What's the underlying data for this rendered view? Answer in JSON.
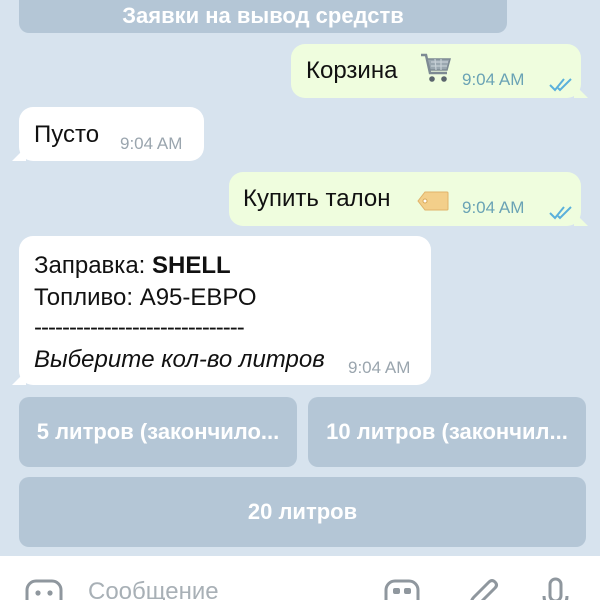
{
  "keyboard": {
    "top_button": "Заявки на вывод средств",
    "button_5l": "5 литров (закончило...",
    "button_10l": "10 литров (закончил...",
    "button_20l": "20 литров"
  },
  "messages": [
    {
      "direction": "out",
      "text": "Корзина",
      "emoji": "🛒",
      "time": "9:04 AM",
      "status": "read"
    },
    {
      "direction": "in",
      "text": "Пусто",
      "time": "9:04 AM"
    },
    {
      "direction": "out",
      "text": "Купить талон",
      "emoji": "🏷",
      "time": "9:04 AM",
      "status": "read"
    },
    {
      "direction": "in",
      "line1_label": "Заправка: ",
      "line1_value": "SHELL",
      "line2": "Топливо: А95-ЕВРО",
      "line3": "------------------------------",
      "line4": "Выберите кол-во литров",
      "time": "9:04 AM"
    }
  ],
  "input": {
    "placeholder": "Сообщение"
  },
  "icons": {
    "emoji": "emoji-icon",
    "sticker": "sticker-icon",
    "attach": "paperclip-icon",
    "mic": "microphone-icon"
  },
  "colors": {
    "background": "#d7e3ee",
    "outgoing_bubble": "#effdde",
    "incoming_bubble": "#ffffff",
    "keyboard_button": "#b4c6d6",
    "read_ticks": "#5ab0db"
  }
}
